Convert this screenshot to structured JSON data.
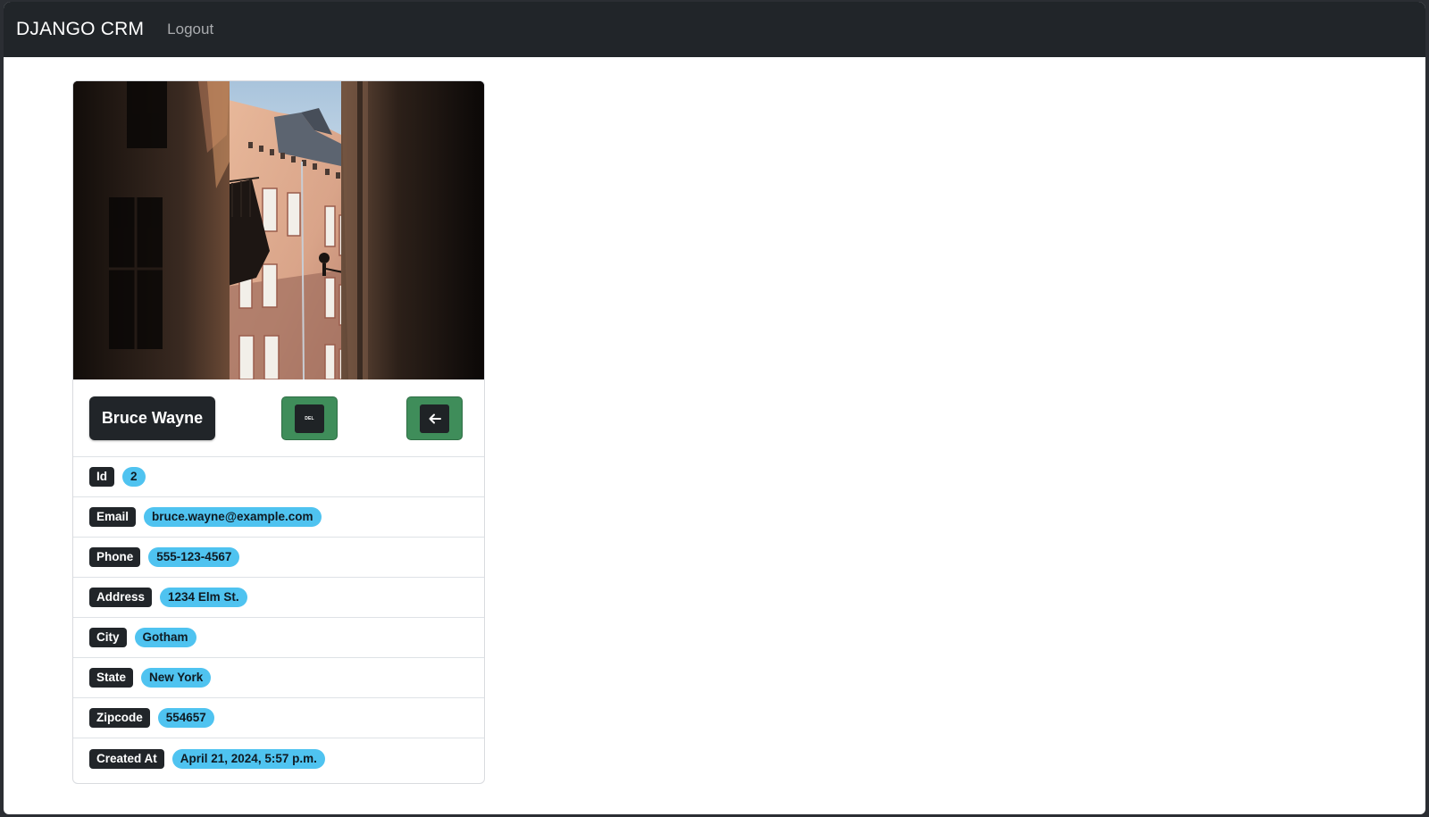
{
  "navbar": {
    "brand": "DJANGO CRM",
    "logout_label": "Logout"
  },
  "record": {
    "photo_icon": "building-street-photo",
    "name_label": "Bruce Wayne",
    "delete_label": "DEL",
    "back_icon": "arrow-left-icon",
    "fields": [
      {
        "label": "Id",
        "value": "2"
      },
      {
        "label": "Email",
        "value": "bruce.wayne@example.com"
      },
      {
        "label": "Phone",
        "value": "555-123-4567"
      },
      {
        "label": "Address",
        "value": "1234 Elm St."
      },
      {
        "label": "City",
        "value": "Gotham"
      },
      {
        "label": "State",
        "value": "New York"
      },
      {
        "label": "Zipcode",
        "value": "554657"
      },
      {
        "label": "Created At",
        "value": "April 21, 2024, 5:57 p.m."
      }
    ]
  },
  "colors": {
    "navbar_bg": "#212529",
    "button_green": "#3f8d5a",
    "badge_value_bg": "#4fc3f0",
    "badge_label_bg": "#212529"
  }
}
